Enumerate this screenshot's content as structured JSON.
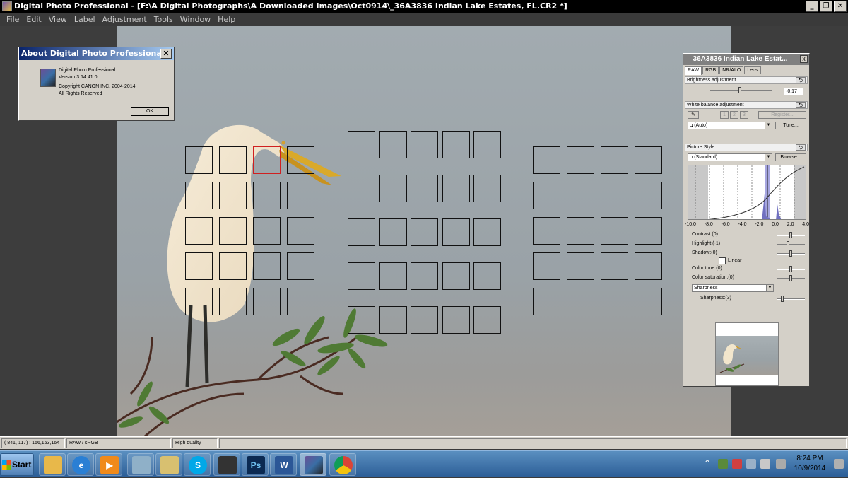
{
  "window": {
    "title": "Digital Photo Professional - [F:\\A Digital Photographs\\A Downloaded Images\\Oct0914\\_36A3836  Indian Lake Estates, FL.CR2 *]",
    "minimize": "_",
    "restore": "❐",
    "close": "✕"
  },
  "menu": [
    "File",
    "Edit",
    "View",
    "Label",
    "Adjustment",
    "Tools",
    "Window",
    "Help"
  ],
  "about_dialog": {
    "title": "About Digital Photo Professional",
    "close": "✕",
    "lines": [
      "Digital Photo Professional",
      "Version 3.14.41.0",
      "",
      "Copyright CANON INC. 2004-2014",
      "All Rights Reserved"
    ],
    "ok": "OK"
  },
  "tool_palette": {
    "title": "_36A3836  Indian Lake Estat...",
    "close": "x",
    "tabs": [
      "RAW",
      "RGB",
      "NR/ALO",
      "Lens"
    ],
    "brightness": {
      "header": "Brightness adjustment",
      "value": "-0.17",
      "level": -0.17
    },
    "white_balance": {
      "header": "White balance adjustment",
      "presets": [
        "1",
        "2",
        "3"
      ],
      "register": "Register...",
      "value": "(Auto)",
      "tune": "Tune..."
    },
    "picture_style": {
      "header": "Picture Style",
      "value": "(Standard)",
      "browse": "Browse...",
      "ticks": [
        "-10.0",
        "-8.0",
        "-6.0",
        "-4.0",
        "-2.0",
        "0.0",
        "2.0",
        "4.0"
      ],
      "linear": "Linear",
      "params": [
        {
          "label": "Contrast:(0)",
          "value": 0
        },
        {
          "label": "Highlight:(-1)",
          "value": -1
        },
        {
          "label": "Shadow:(0)",
          "value": 0
        }
      ],
      "color_params": [
        {
          "label": "Color tone:(0)",
          "value": 0
        },
        {
          "label": "Color saturation:(0)",
          "value": 0
        }
      ],
      "sharpness_select": "Sharpness",
      "sharpness": {
        "label": "Sharpness:(3)",
        "value": 3
      }
    },
    "reset_icon": "reset-arrow-icon"
  },
  "status_bar": {
    "coords": "( 841, 117) : 156,163,164",
    "format": "RAW / sRGB",
    "quality": "High quality"
  },
  "taskbar": {
    "start": "Start",
    "apps": [
      "explorer",
      "internet-explorer",
      "media-player",
      "calculator",
      "windows-explorer",
      "skype",
      "camera",
      "Ps",
      "W",
      "digital-photo-professional",
      "chrome"
    ],
    "tray_up": "⌃",
    "time": "8:24 PM",
    "date": "10/9/2014"
  },
  "colors": {
    "af_selected": "#d02020",
    "af_normal": "#111111",
    "titlebar": "#000000"
  },
  "af_points": {
    "selected_group": 0,
    "selected_row": 0,
    "selected_col": 2
  }
}
